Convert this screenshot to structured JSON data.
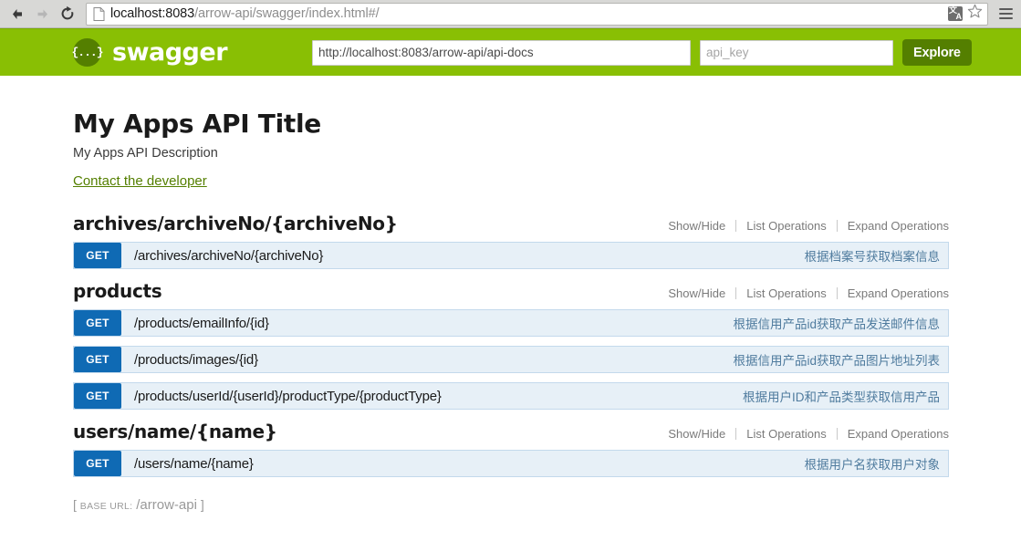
{
  "browser": {
    "back_icon": "back-arrow-icon",
    "forward_icon": "forward-arrow-icon",
    "reload_icon": "reload-icon",
    "url_host": "localhost:8083",
    "url_path": "/arrow-api/swagger/index.html#/",
    "url_full": "localhost:8083/arrow-api/swagger/index.html#/",
    "translate_icon_primary": "文",
    "translate_icon_secondary": "A",
    "star_icon": "bookmark-star-icon",
    "menu_icon": "hamburger-menu-icon"
  },
  "header": {
    "logo_glyph": "{...}",
    "logo_text": "swagger",
    "spec_url_value": "http://localhost:8083/arrow-api/api-docs",
    "api_key_placeholder": "api_key",
    "api_key_value": "",
    "explore_label": "Explore"
  },
  "info": {
    "title": "My Apps API Title",
    "description": "My Apps API Description",
    "contact_label": "Contact the developer"
  },
  "resource_options": {
    "show_hide": "Show/Hide",
    "list_operations": "List Operations",
    "expand_operations": "Expand Operations"
  },
  "resources": [
    {
      "name": "archives/archiveNo/{archiveNo}",
      "operations": [
        {
          "method": "GET",
          "path": "/archives/archiveNo/{archiveNo}",
          "summary": "根据档案号获取档案信息"
        }
      ]
    },
    {
      "name": "products",
      "operations": [
        {
          "method": "GET",
          "path": "/products/emailInfo/{id}",
          "summary": "根据信用产品id获取产品发送邮件信息"
        },
        {
          "method": "GET",
          "path": "/products/images/{id}",
          "summary": "根据信用产品id获取产品图片地址列表"
        },
        {
          "method": "GET",
          "path": "/products/userId/{userId}/productType/{productType}",
          "summary": "根据用户ID和产品类型获取信用产品"
        }
      ]
    },
    {
      "name": "users/name/{name}",
      "operations": [
        {
          "method": "GET",
          "path": "/users/name/{name}",
          "summary": "根据用户名获取用户对象"
        }
      ]
    }
  ],
  "footer": {
    "bracket_open": "[",
    "base_url_label": "BASE URL:",
    "base_url_value": "/arrow-api",
    "bracket_close": "]"
  },
  "colors": {
    "brand_green": "#89bf04",
    "dark_green": "#547f00",
    "get_blue": "#0f6ab4",
    "op_row_bg": "#e7f0f7",
    "op_row_border": "#c3d9ec",
    "summary_text": "#4f7b9e"
  }
}
